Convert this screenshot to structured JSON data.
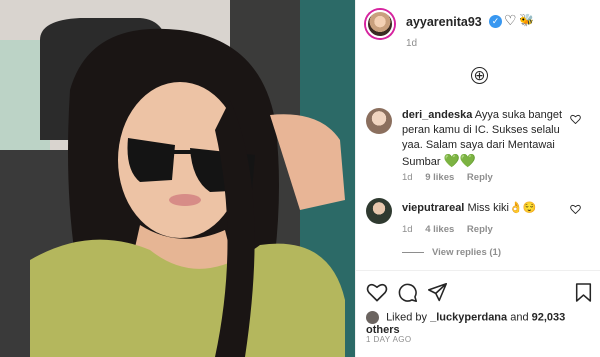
{
  "post": {
    "username": "ayyarenita93",
    "verified_mark": "✓",
    "emoji_heart": "♡",
    "emoji_bee": "🐝",
    "time_top": "1d",
    "load_more_icon": "⊕"
  },
  "comments": [
    {
      "user": "deri_andeska",
      "text": "Ayya suka banget peran kamu di IC. Sukses selalu yaa. Salam saya dari Mentawai Sumbar",
      "emoji": "💚💚",
      "time": "1d",
      "likes": "9 likes",
      "reply": "Reply"
    },
    {
      "user": "vieputrareal",
      "text": "Miss kiki",
      "emoji": "👌😌",
      "time": "1d",
      "likes": "4 likes",
      "reply": "Reply"
    }
  ],
  "view_replies": "View replies (1)",
  "liked_by": {
    "prefix": "Liked by",
    "user": "_luckyperdana",
    "connector": "and",
    "count": "92,033 others"
  },
  "date": "1 DAY AGO",
  "colors": {
    "accent_blue": "#3897f0",
    "muted_text": "#8e8e8e",
    "green_heart": "#26c441"
  },
  "icons": [
    "heart-icon",
    "comment-icon",
    "share-icon",
    "bookmark-icon"
  ]
}
